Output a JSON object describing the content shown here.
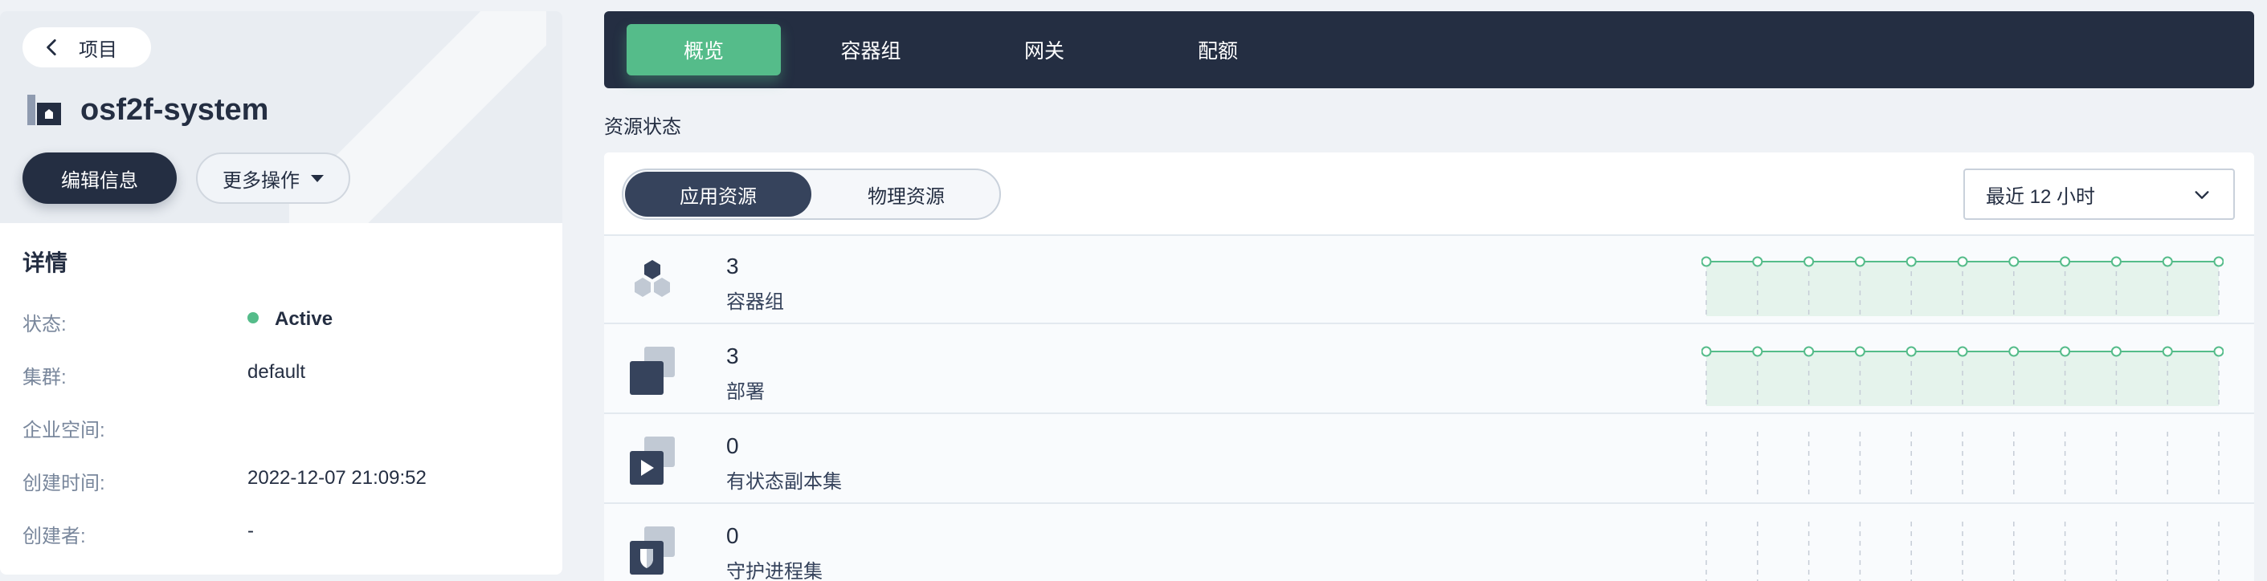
{
  "back": {
    "label": "项目"
  },
  "project": {
    "name": "osf2f-system"
  },
  "actions": {
    "edit": "编辑信息",
    "more": "更多操作"
  },
  "details": {
    "title": "详情",
    "rows": [
      {
        "key": "状态:",
        "value": "Active"
      },
      {
        "key": "集群:",
        "value": "default"
      },
      {
        "key": "企业空间:",
        "value": ""
      },
      {
        "key": "创建时间:",
        "value": "2022-12-07 21:09:52"
      },
      {
        "key": "创建者:",
        "value": "-"
      }
    ]
  },
  "tabs": [
    {
      "label": "概览",
      "active": true
    },
    {
      "label": "容器组",
      "active": false
    },
    {
      "label": "网关",
      "active": false
    },
    {
      "label": "配额",
      "active": false
    }
  ],
  "resource_status": {
    "title": "资源状态",
    "segments": [
      "应用资源",
      "物理资源"
    ],
    "time_range": "最近 12 小时",
    "items": [
      {
        "count": "3",
        "label": "容器组",
        "icon": "pod-hexagon-icon",
        "has_line": true
      },
      {
        "count": "3",
        "label": "部署",
        "icon": "deployment-icon",
        "has_line": true
      },
      {
        "count": "0",
        "label": "有状态副本集",
        "icon": "statefulset-play-icon",
        "has_line": false
      },
      {
        "count": "0",
        "label": "守护进程集",
        "icon": "daemonset-shield-icon",
        "has_line": false
      }
    ]
  },
  "colors": {
    "accent": "#55bc8a",
    "dark": "#242e42"
  }
}
